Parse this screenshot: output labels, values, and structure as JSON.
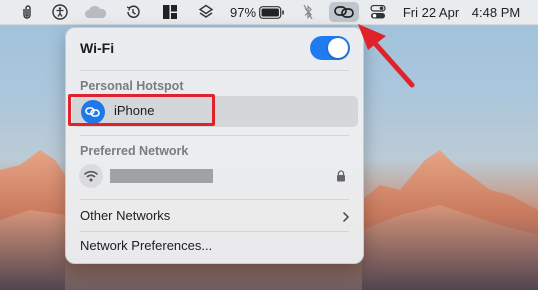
{
  "menubar": {
    "battery_percent": "97%",
    "date": "Fri 22 Apr",
    "time": "4:48 PM"
  },
  "wifi_panel": {
    "title": "Wi-Fi",
    "toggle_on": true,
    "personal_hotspot_header": "Personal Hotspot",
    "hotspot_device": "iPhone",
    "preferred_network_header": "Preferred Network",
    "other_networks_label": "Other Networks",
    "network_preferences_label": "Network Preferences..."
  },
  "colors": {
    "toggle_accent": "#1f7bef",
    "highlight_red": "#e0232b"
  },
  "icons": {
    "menubar": [
      "paperclip-icon",
      "accessibility-icon",
      "cloud-icon",
      "time-machine-icon",
      "window-grid-icon",
      "layers-icon",
      "battery-icon",
      "bluetooth-icon",
      "personal-hotspot-icon",
      "control-center-icon"
    ],
    "panel": [
      "hotspot-link-icon",
      "wifi-signal-icon",
      "lock-icon",
      "chevron-right-icon"
    ]
  }
}
